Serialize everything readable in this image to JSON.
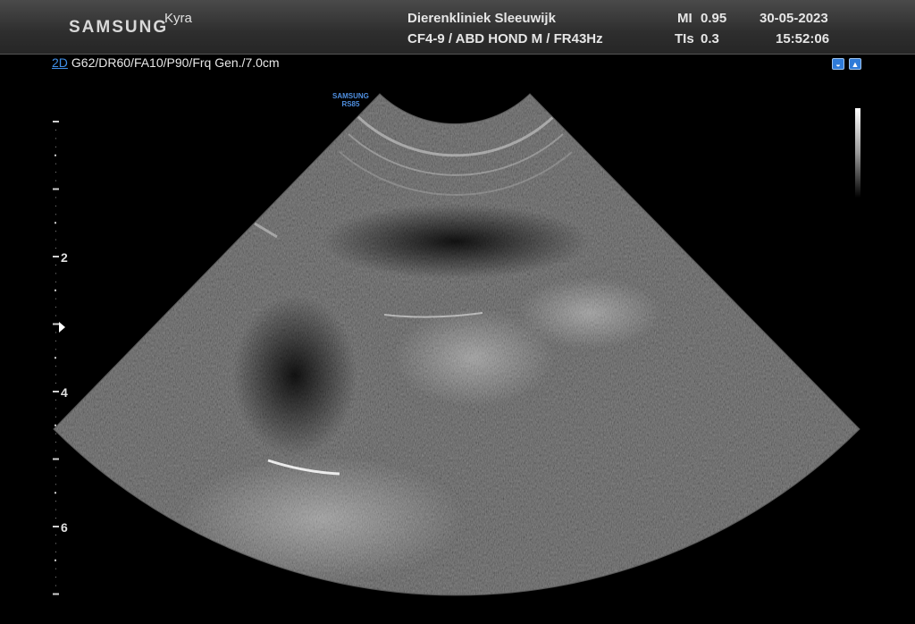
{
  "header": {
    "brand": "SAMSUNG",
    "patient": "Kyra",
    "clinic": "Dierenkliniek Sleeuwijk",
    "probe_preset": "CF4-9 / ABD HOND M / FR43Hz",
    "mi_label": "MI",
    "mi_value": "0.95",
    "tis_label": "TIs",
    "tis_value": "0.3",
    "date": "30-05-2023",
    "time": "15:52:06"
  },
  "imaging": {
    "mode": "2D",
    "parameters": "G62/DR60/FA10/P90/Frq Gen./7.0cm"
  },
  "watermark": {
    "line1": "SAMSUNG",
    "line2": "RS85"
  },
  "depth_scale": {
    "labels": [
      "2",
      "4",
      "6"
    ],
    "unit": "cm"
  },
  "icons": {
    "left": "probe-orientation-icon",
    "right": "body-marker-icon"
  }
}
